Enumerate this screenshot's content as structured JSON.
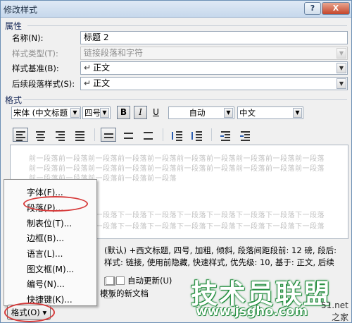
{
  "window": {
    "title": "修改样式",
    "help_label": "?",
    "close_label": "X"
  },
  "properties": {
    "section_label": "属性",
    "name": {
      "label": "名称(N):",
      "value": "标题 2"
    },
    "style_type": {
      "label": "样式类型(T):",
      "value": "链接段落和字符"
    },
    "style_based_on": {
      "label": "样式基准(B):",
      "value": "正文"
    },
    "next_style": {
      "label": "后续段落样式(S):",
      "value": "正文"
    }
  },
  "format": {
    "section_label": "格式",
    "font": "宋体 (中文标题",
    "size": "四号",
    "bold_label": "B",
    "italic_label": "I",
    "underline_label": "U",
    "color": "自动",
    "language": "中文"
  },
  "preview": {
    "prev_line1": "前一段落前一段落前一段落前一段落前一段落前一段落前一段落前一段落前一段落前一段落",
    "prev_line2": "前一段落前一段落前一段落前一段落前一段落前一段落前一段落前一段落前一段落前一段落",
    "prev_line3": "前一段落前一段落前一段落前一段落前一段落",
    "next_line1": "下一段落下一段落下一段落下一段落下一段落下一段落下一段落下一段落下一段落下一段落",
    "next_line2": "下一段落下一段落下一段落下一段落下一段落下一段落下一段落下一段落下一段落下一段落"
  },
  "description": {
    "line1": "(默认) +西文标题, 四号, 加粗, 倾斜, 段落间距段前: 12 磅, 段后:",
    "line2": "样式: 链接, 使用前隐藏, 快速样式, 优先级: 10, 基于: 正文, 后续"
  },
  "options": {
    "auto_update_label": "自动更新(U)",
    "new_doc_label": "模板的新文档"
  },
  "format_menu": {
    "items": [
      "字体(F)...",
      "段落(P)...",
      "制表位(T)...",
      "边框(B)...",
      "语言(L)...",
      "图文框(M)...",
      "编号(N)...",
      "快捷键(K)..."
    ]
  },
  "format_button_label": "格式(O) ▾",
  "watermark": {
    "brand": "技术员联盟",
    "url": "www.jsgho.com",
    "corner1": "51.net",
    "corner2": "之家"
  }
}
